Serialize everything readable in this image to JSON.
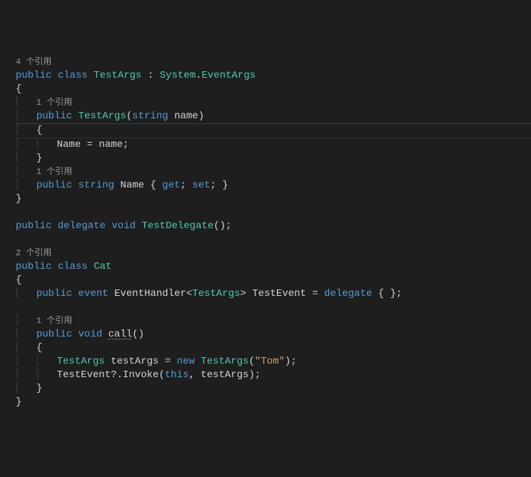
{
  "refs": {
    "r4": "4 个引用",
    "r1a": "1 个引用",
    "r1b": "1 个引用",
    "r2": "2 个引用",
    "r1c": "1 个引用"
  },
  "kw": {
    "public": "public",
    "class": "class",
    "string": "string",
    "get": "get",
    "set": "set",
    "delegate": "delegate",
    "void": "void",
    "event": "event",
    "new": "new",
    "this": "this"
  },
  "types": {
    "TestArgs": "TestArgs",
    "System": "System",
    "EventArgs": "EventArgs",
    "TestDelegate": "TestDelegate",
    "Cat": "Cat",
    "EventHandler": "EventHandler"
  },
  "ids": {
    "name": "name",
    "Name": "Name",
    "TestEvent": "TestEvent",
    "call": "call",
    "testArgs": "testArgs",
    "Invoke": "Invoke"
  },
  "strings": {
    "tom": "\"Tom\""
  }
}
